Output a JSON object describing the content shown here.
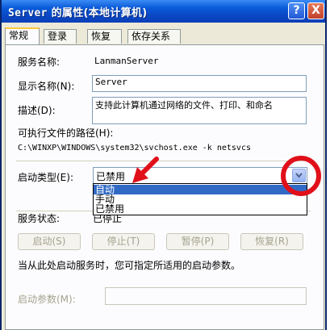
{
  "window": {
    "title_part1": "Server",
    "title_part2": " 的属性(本地计算机)",
    "help_label": "?",
    "close_label": "X"
  },
  "tabs": [
    {
      "label": "常规",
      "active": true
    },
    {
      "label": "登录",
      "active": false
    },
    {
      "label": "恢复",
      "active": false
    },
    {
      "label": "依存关系",
      "active": false
    }
  ],
  "general": {
    "service_name_label": "服务名称:",
    "service_name_value": "LanmanServer",
    "display_name_label": "显示名称(N):",
    "display_name_value": "Server",
    "description_label": "描述(D):",
    "description_value": "支持此计算机通过网络的文件、打印、和命名",
    "exe_path_label": "可执行文件的路径(H):",
    "exe_path_value": "C:\\WINXP\\WINDOWS\\system32\\svchost.exe -k netsvcs",
    "startup_type_label": "启动类型(E):",
    "startup_type_value": "已禁用",
    "startup_options": [
      "自动",
      "手动",
      "已禁用"
    ],
    "service_status_label": "服务状态:",
    "service_status_value": "已停止",
    "buttons": {
      "start": "启动(S)",
      "stop": "停止(T)",
      "pause": "暂停(P)",
      "resume": "恢复(R)"
    },
    "hint": "当从此处启动服务时，您可指定所适用的启动参数。",
    "start_params_label": "启动参数(M):",
    "start_params_value": ""
  },
  "colors": {
    "titlebar": "#0a46c4",
    "annotation": "#e0101a",
    "selection": "#316ac5"
  }
}
